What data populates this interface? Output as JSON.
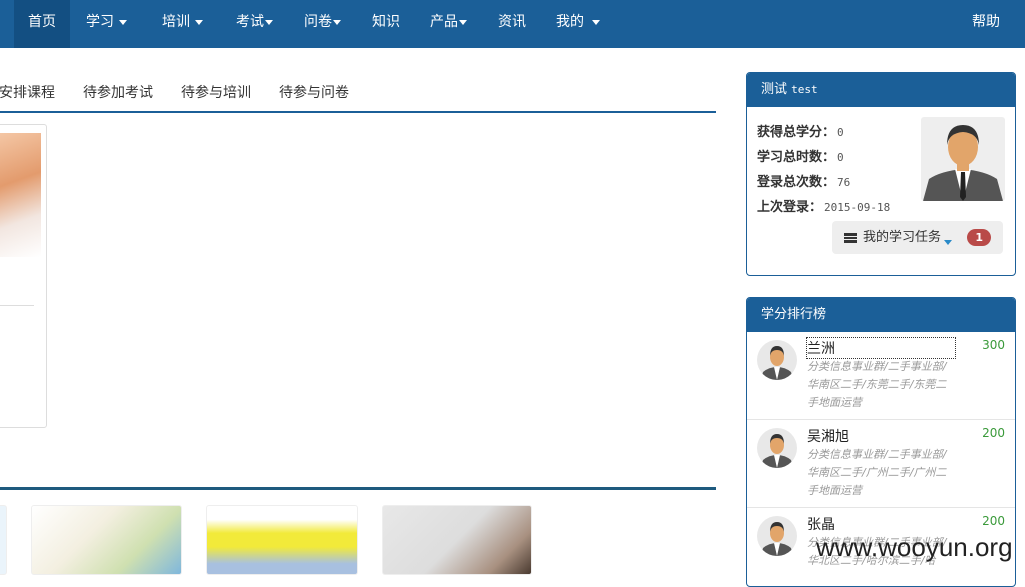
{
  "nav": {
    "items": [
      {
        "label": "首页",
        "caret": false
      },
      {
        "label": "学习",
        "caret": true
      },
      {
        "label": "培训",
        "caret": true
      },
      {
        "label": "考试",
        "caret": true
      },
      {
        "label": "问卷",
        "caret": true
      },
      {
        "label": "知识",
        "caret": false
      },
      {
        "label": "产品",
        "caret": true
      },
      {
        "label": "资讯",
        "caret": false
      },
      {
        "label": "我的",
        "caret": true
      }
    ],
    "help": "帮助"
  },
  "tabs": [
    "安排课程",
    "待参加考试",
    "待参与培训",
    "待参与问卷"
  ],
  "profile": {
    "title_cn": "测试",
    "title_en": "test",
    "stats": [
      {
        "label": "获得总学分：",
        "value": "0"
      },
      {
        "label": "学习总时数：",
        "value": "0"
      },
      {
        "label": "登录总次数：",
        "value": "76"
      },
      {
        "label": "上次登录：",
        "value": "2015-09-18"
      }
    ],
    "task_button": "我的学习任务",
    "task_count": "1"
  },
  "ranking": {
    "title": "学分排行榜",
    "items": [
      {
        "name": "兰洲",
        "dept": "分类信息事业群/二手事业部/华南区二手/东莞二手/东莞二手地面运营",
        "score": "300"
      },
      {
        "name": "吴湘旭",
        "dept": "分类信息事业群/二手事业部/华南区二手/广州二手/广州二手地面运营",
        "score": "200"
      },
      {
        "name": "张晶",
        "dept": "分类信息事业群/二手事业部/华北区二手/哈尔滨二手/哈",
        "score": "200"
      }
    ]
  },
  "watermark": "www.wooyun.org",
  "colors": {
    "primary": "#1b5f98",
    "badge": "#b94a48",
    "score": "#3a9a3a"
  }
}
